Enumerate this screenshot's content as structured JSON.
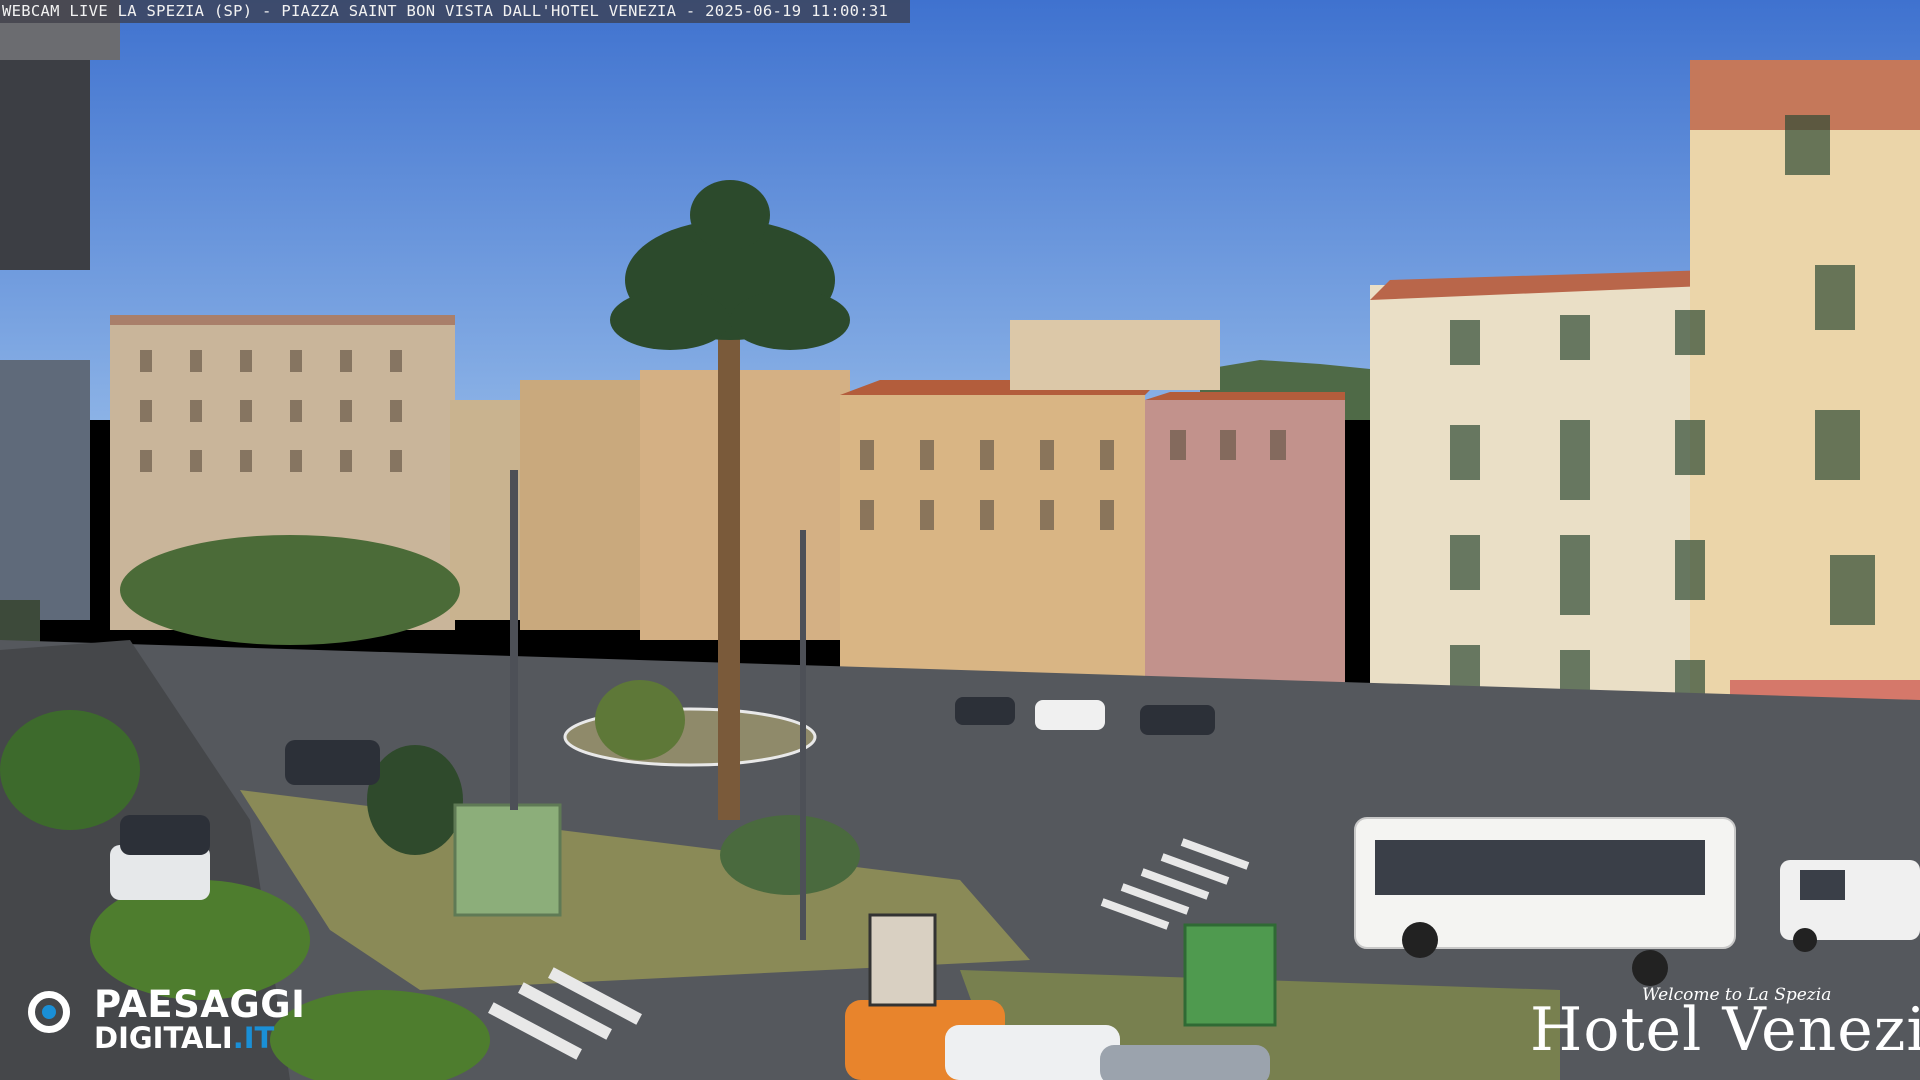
{
  "caption": "WEBCAM LIVE LA SPEZIA (SP) - PIAZZA SAINT BON VISTA DALL'HOTEL VENEZIA - 2025-06-19 11:00:31",
  "logos": {
    "paesaggi_line1": "PAESAGGI",
    "paesaggi_line2_main": "DIGITALI",
    "paesaggi_line2_suffix": ".IT",
    "hotel_welcome": "Welcome to La Spezia",
    "hotel_name": "Hotel Venezia"
  },
  "colors": {
    "sky": "#5f8ed6",
    "road": "#56585c",
    "brand_blue": "#1a8fd6",
    "bus": "#f4f4f2",
    "car_orange": "#e8842c"
  },
  "scene": {
    "subject": "roundabout square with palm tree",
    "elements": [
      "buildings",
      "palm-tree",
      "roundabout",
      "bus",
      "cars",
      "crosswalk",
      "green-kiosks"
    ]
  }
}
